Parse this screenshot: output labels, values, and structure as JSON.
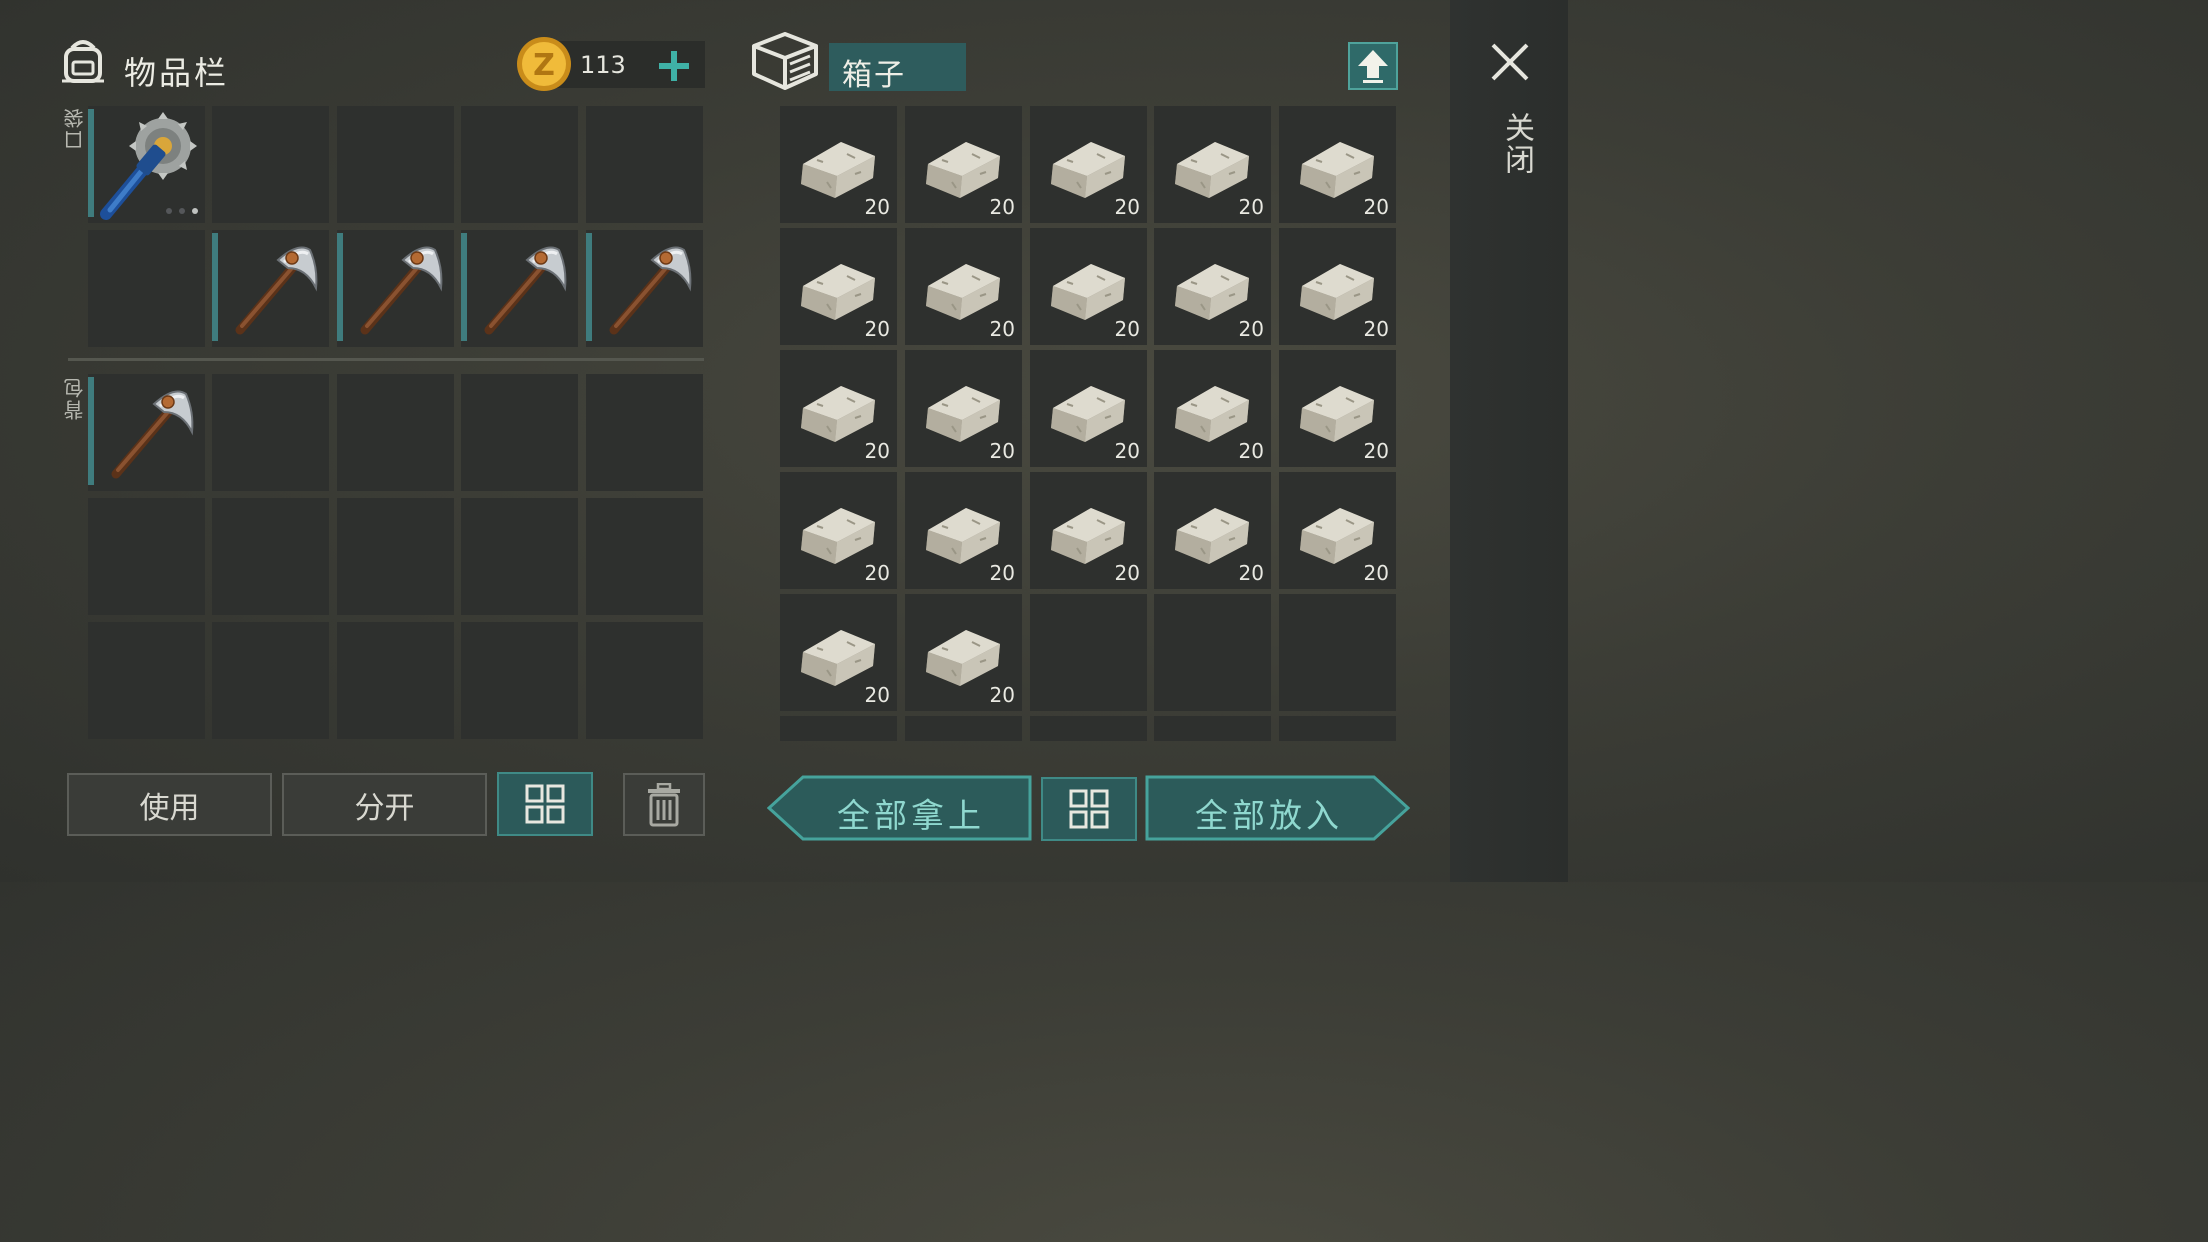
{
  "inventory": {
    "title": "物品栏",
    "pocket_label": "口袋",
    "backpack_label": "背包",
    "coins": "113",
    "pocket_slots": [
      "saw-tool",
      "",
      "",
      "",
      "",
      "",
      "pickaxe",
      "pickaxe",
      "pickaxe",
      "pickaxe"
    ],
    "backpack_slots": [
      "pickaxe",
      "",
      "",
      "",
      "",
      "",
      "",
      "",
      "",
      "",
      "",
      "",
      "",
      "",
      ""
    ]
  },
  "container": {
    "title": "箱子",
    "slots": [
      {
        "item": "stone",
        "count": "20"
      },
      {
        "item": "stone",
        "count": "20"
      },
      {
        "item": "stone",
        "count": "20"
      },
      {
        "item": "stone",
        "count": "20"
      },
      {
        "item": "stone",
        "count": "20"
      },
      {
        "item": "stone",
        "count": "20"
      },
      {
        "item": "stone",
        "count": "20"
      },
      {
        "item": "stone",
        "count": "20"
      },
      {
        "item": "stone",
        "count": "20"
      },
      {
        "item": "stone",
        "count": "20"
      },
      {
        "item": "stone",
        "count": "20"
      },
      {
        "item": "stone",
        "count": "20"
      },
      {
        "item": "stone",
        "count": "20"
      },
      {
        "item": "stone",
        "count": "20"
      },
      {
        "item": "stone",
        "count": "20"
      },
      {
        "item": "stone",
        "count": "20"
      },
      {
        "item": "stone",
        "count": "20"
      },
      {
        "item": "stone",
        "count": "20"
      },
      {
        "item": "stone",
        "count": "20"
      },
      {
        "item": "stone",
        "count": "20"
      },
      {
        "item": "stone",
        "count": "20"
      },
      {
        "item": "stone",
        "count": "20"
      },
      {
        "item": "",
        "count": ""
      },
      {
        "item": "",
        "count": ""
      },
      {
        "item": "",
        "count": ""
      }
    ]
  },
  "buttons": {
    "use": "使用",
    "split": "分开",
    "take_all": "全部拿上",
    "put_all": "全部放入"
  },
  "close_label": "关闭",
  "colors": {
    "accent_teal": "#3f8a86",
    "coin_gold": "#e0a92a"
  }
}
